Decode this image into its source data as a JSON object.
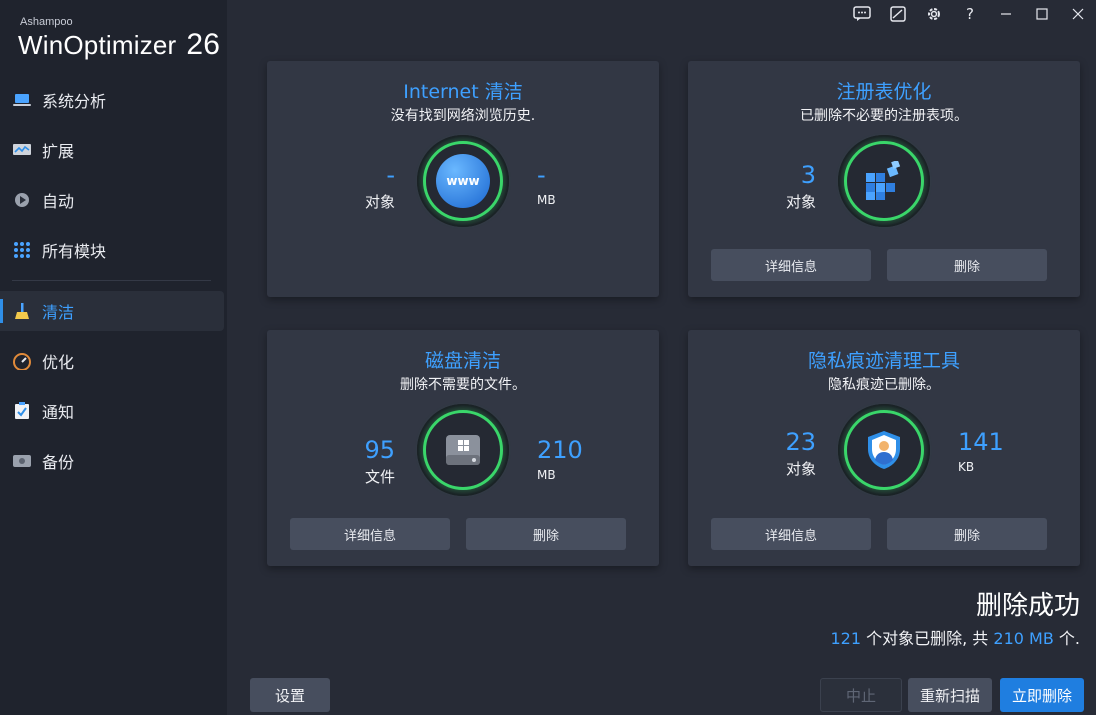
{
  "brand": {
    "company": "Ashampoo",
    "product": "WinOptimizer",
    "version": "26"
  },
  "sidebar": {
    "items": [
      {
        "label": "系统分析",
        "icon": "laptop-icon"
      },
      {
        "label": "扩展",
        "icon": "monitor-chart-icon"
      },
      {
        "label": "自动",
        "icon": "play-gear-icon"
      },
      {
        "label": "所有模块",
        "icon": "grid-dots-icon"
      },
      {
        "label": "清洁",
        "icon": "broom-icon",
        "active": true
      },
      {
        "label": "优化",
        "icon": "speedometer-icon"
      },
      {
        "label": "通知",
        "icon": "clipboard-check-icon"
      },
      {
        "label": "备份",
        "icon": "hard-drive-icon"
      }
    ]
  },
  "titlebar": {
    "buttons": [
      "feedback-icon",
      "skin-icon",
      "gear-icon",
      "help-icon",
      "minimize-icon",
      "maximize-icon",
      "close-icon"
    ],
    "help_glyph": "?"
  },
  "cards": {
    "internet": {
      "title": "Internet 清洁",
      "subtitle": "没有找到网络浏览历史.",
      "left_value": "-",
      "left_unit": "对象",
      "right_value": "-",
      "right_unit": "MB",
      "icon_text": "www"
    },
    "registry": {
      "title": "注册表优化",
      "subtitle": "已删除不必要的注册表项。",
      "left_value": "3",
      "left_unit": "对象",
      "details_label": "详细信息",
      "delete_label": "删除"
    },
    "disk": {
      "title": "磁盘清洁",
      "subtitle": "删除不需要的文件。",
      "left_value": "95",
      "left_unit": "文件",
      "right_value": "210",
      "right_unit": "MB",
      "details_label": "详细信息",
      "delete_label": "删除"
    },
    "privacy": {
      "title": "隐私痕迹清理工具",
      "subtitle": "隐私痕迹已删除。",
      "left_value": "23",
      "left_unit": "对象",
      "right_value": "141",
      "right_unit": "KB",
      "details_label": "详细信息",
      "delete_label": "删除"
    }
  },
  "result": {
    "title": "删除成功",
    "count": "121",
    "text_a": " 个对象已删除, 共 ",
    "size": "210 MB",
    "text_b": " 个."
  },
  "buttons": {
    "settings": "设置",
    "stop": "中止",
    "rescan": "重新扫描",
    "delete_now": "立即删除"
  },
  "colors": {
    "accent": "#3ea0ff",
    "ring": "#3ad66a",
    "primary_button": "#1f7ee0"
  }
}
